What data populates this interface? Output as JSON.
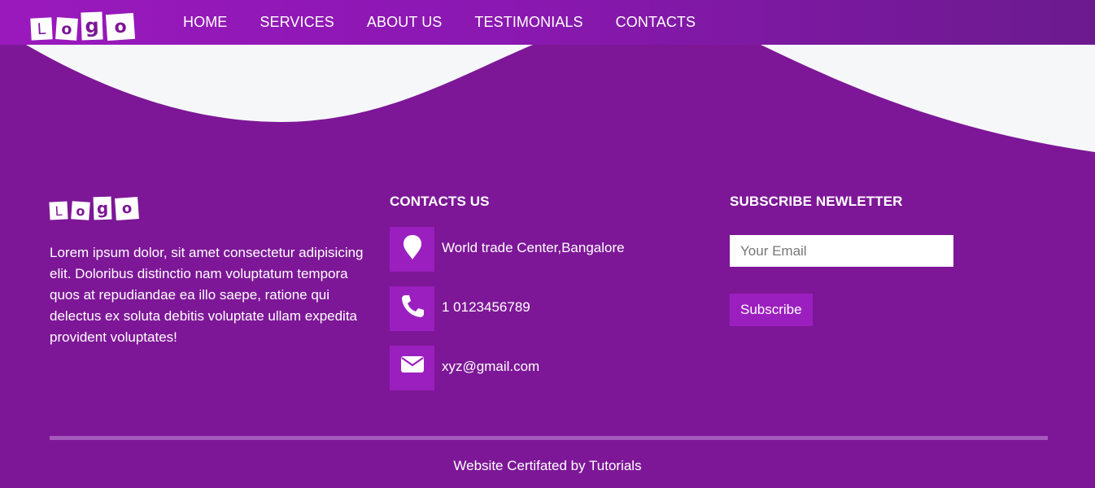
{
  "brand": {
    "logo_letters": [
      "L",
      "o",
      "g",
      "o"
    ]
  },
  "nav": {
    "items": [
      {
        "label": "HOME"
      },
      {
        "label": "SERVICES"
      },
      {
        "label": "ABOUT US"
      },
      {
        "label": "TESTIMONIALS"
      },
      {
        "label": "CONTACTS"
      }
    ]
  },
  "footer": {
    "about": {
      "logo_letters": [
        "L",
        "o",
        "g",
        "o"
      ],
      "text": "Lorem ipsum dolor, sit amet consectetur adipisicing elit. Doloribus distinctio nam voluptatum tempora quos at repudiandae ea illo saepe, ratione qui delectus ex soluta debitis voluptate ullam expedita provident voluptates!"
    },
    "contacts": {
      "title": "CONTACTS US",
      "items": [
        {
          "icon": "location-pin-icon",
          "text": "World trade Center,Bangalore"
        },
        {
          "icon": "phone-icon",
          "text": "1 0123456789"
        },
        {
          "icon": "envelope-icon",
          "text": "xyz@gmail.com"
        }
      ]
    },
    "subscribe": {
      "title": "SUBSCRIBE NEWLETTER",
      "email_placeholder": "Your Email",
      "email_value": "",
      "button_label": "Subscribe"
    },
    "copyright": "Website Certifated by Tutorials"
  },
  "colors": {
    "background": "#7d1797",
    "accent": "#9b1fbf",
    "wave": "#f6f7f9",
    "divider": "#a55bbd"
  }
}
